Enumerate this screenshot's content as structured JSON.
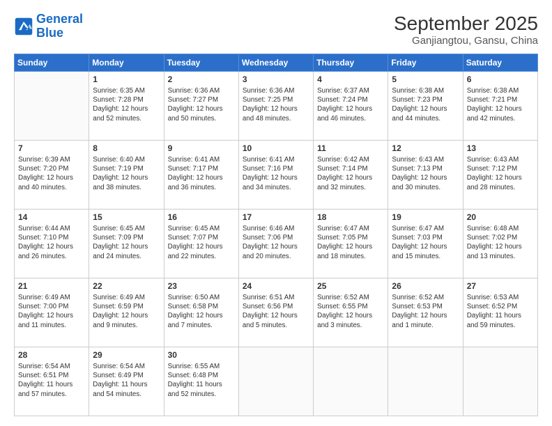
{
  "logo": {
    "line1": "General",
    "line2": "Blue"
  },
  "title": "September 2025",
  "subtitle": "Ganjiangtou, Gansu, China",
  "days_header": [
    "Sunday",
    "Monday",
    "Tuesday",
    "Wednesday",
    "Thursday",
    "Friday",
    "Saturday"
  ],
  "weeks": [
    [
      {
        "num": "",
        "info": ""
      },
      {
        "num": "1",
        "info": "Sunrise: 6:35 AM\nSunset: 7:28 PM\nDaylight: 12 hours\nand 52 minutes."
      },
      {
        "num": "2",
        "info": "Sunrise: 6:36 AM\nSunset: 7:27 PM\nDaylight: 12 hours\nand 50 minutes."
      },
      {
        "num": "3",
        "info": "Sunrise: 6:36 AM\nSunset: 7:25 PM\nDaylight: 12 hours\nand 48 minutes."
      },
      {
        "num": "4",
        "info": "Sunrise: 6:37 AM\nSunset: 7:24 PM\nDaylight: 12 hours\nand 46 minutes."
      },
      {
        "num": "5",
        "info": "Sunrise: 6:38 AM\nSunset: 7:23 PM\nDaylight: 12 hours\nand 44 minutes."
      },
      {
        "num": "6",
        "info": "Sunrise: 6:38 AM\nSunset: 7:21 PM\nDaylight: 12 hours\nand 42 minutes."
      }
    ],
    [
      {
        "num": "7",
        "info": "Sunrise: 6:39 AM\nSunset: 7:20 PM\nDaylight: 12 hours\nand 40 minutes."
      },
      {
        "num": "8",
        "info": "Sunrise: 6:40 AM\nSunset: 7:19 PM\nDaylight: 12 hours\nand 38 minutes."
      },
      {
        "num": "9",
        "info": "Sunrise: 6:41 AM\nSunset: 7:17 PM\nDaylight: 12 hours\nand 36 minutes."
      },
      {
        "num": "10",
        "info": "Sunrise: 6:41 AM\nSunset: 7:16 PM\nDaylight: 12 hours\nand 34 minutes."
      },
      {
        "num": "11",
        "info": "Sunrise: 6:42 AM\nSunset: 7:14 PM\nDaylight: 12 hours\nand 32 minutes."
      },
      {
        "num": "12",
        "info": "Sunrise: 6:43 AM\nSunset: 7:13 PM\nDaylight: 12 hours\nand 30 minutes."
      },
      {
        "num": "13",
        "info": "Sunrise: 6:43 AM\nSunset: 7:12 PM\nDaylight: 12 hours\nand 28 minutes."
      }
    ],
    [
      {
        "num": "14",
        "info": "Sunrise: 6:44 AM\nSunset: 7:10 PM\nDaylight: 12 hours\nand 26 minutes."
      },
      {
        "num": "15",
        "info": "Sunrise: 6:45 AM\nSunset: 7:09 PM\nDaylight: 12 hours\nand 24 minutes."
      },
      {
        "num": "16",
        "info": "Sunrise: 6:45 AM\nSunset: 7:07 PM\nDaylight: 12 hours\nand 22 minutes."
      },
      {
        "num": "17",
        "info": "Sunrise: 6:46 AM\nSunset: 7:06 PM\nDaylight: 12 hours\nand 20 minutes."
      },
      {
        "num": "18",
        "info": "Sunrise: 6:47 AM\nSunset: 7:05 PM\nDaylight: 12 hours\nand 18 minutes."
      },
      {
        "num": "19",
        "info": "Sunrise: 6:47 AM\nSunset: 7:03 PM\nDaylight: 12 hours\nand 15 minutes."
      },
      {
        "num": "20",
        "info": "Sunrise: 6:48 AM\nSunset: 7:02 PM\nDaylight: 12 hours\nand 13 minutes."
      }
    ],
    [
      {
        "num": "21",
        "info": "Sunrise: 6:49 AM\nSunset: 7:00 PM\nDaylight: 12 hours\nand 11 minutes."
      },
      {
        "num": "22",
        "info": "Sunrise: 6:49 AM\nSunset: 6:59 PM\nDaylight: 12 hours\nand 9 minutes."
      },
      {
        "num": "23",
        "info": "Sunrise: 6:50 AM\nSunset: 6:58 PM\nDaylight: 12 hours\nand 7 minutes."
      },
      {
        "num": "24",
        "info": "Sunrise: 6:51 AM\nSunset: 6:56 PM\nDaylight: 12 hours\nand 5 minutes."
      },
      {
        "num": "25",
        "info": "Sunrise: 6:52 AM\nSunset: 6:55 PM\nDaylight: 12 hours\nand 3 minutes."
      },
      {
        "num": "26",
        "info": "Sunrise: 6:52 AM\nSunset: 6:53 PM\nDaylight: 12 hours\nand 1 minute."
      },
      {
        "num": "27",
        "info": "Sunrise: 6:53 AM\nSunset: 6:52 PM\nDaylight: 11 hours\nand 59 minutes."
      }
    ],
    [
      {
        "num": "28",
        "info": "Sunrise: 6:54 AM\nSunset: 6:51 PM\nDaylight: 11 hours\nand 57 minutes."
      },
      {
        "num": "29",
        "info": "Sunrise: 6:54 AM\nSunset: 6:49 PM\nDaylight: 11 hours\nand 54 minutes."
      },
      {
        "num": "30",
        "info": "Sunrise: 6:55 AM\nSunset: 6:48 PM\nDaylight: 11 hours\nand 52 minutes."
      },
      {
        "num": "",
        "info": ""
      },
      {
        "num": "",
        "info": ""
      },
      {
        "num": "",
        "info": ""
      },
      {
        "num": "",
        "info": ""
      }
    ]
  ]
}
